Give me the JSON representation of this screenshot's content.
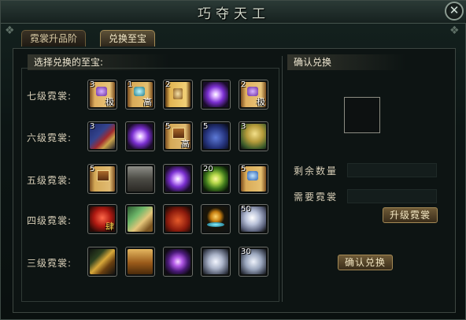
{
  "window": {
    "title": "巧夺天工"
  },
  "tabs": [
    {
      "label": "霓裳升品阶"
    },
    {
      "label": "兑换至宝"
    }
  ],
  "left": {
    "section_title": "选择兑换的至宝:",
    "rows": [
      {
        "label": "七级霓裳:",
        "items": [
          {
            "icon": "purple-seal-scroll-icon",
            "count": "3",
            "mark": "极"
          },
          {
            "icon": "teal-seal-scroll-icon",
            "count": "1",
            "mark": "高"
          },
          {
            "icon": "golden-scroll-icon",
            "count": "2",
            "mark": ""
          },
          {
            "icon": "purple-orb-icon",
            "count": "",
            "mark": ""
          },
          {
            "icon": "purple-seal-scroll-icon",
            "count": "2",
            "mark": "极"
          }
        ]
      },
      {
        "label": "六级霓裳:",
        "items": [
          {
            "icon": "book-box-icon",
            "count": "3",
            "mark": ""
          },
          {
            "icon": "purple-orb-icon",
            "count": "",
            "mark": ""
          },
          {
            "icon": "gold-chest-scroll-icon",
            "count": "5",
            "mark": "高"
          },
          {
            "icon": "blue-chest-icon",
            "count": "5",
            "mark": ""
          },
          {
            "icon": "jade-scroll-icon",
            "count": "3",
            "mark": ""
          }
        ]
      },
      {
        "label": "五级霓裳:",
        "items": [
          {
            "icon": "chest-scroll-icon",
            "count": "5",
            "mark": ""
          },
          {
            "icon": "metal-chest-icon",
            "count": "",
            "mark": ""
          },
          {
            "icon": "purple-orb-icon",
            "count": "",
            "mark": ""
          },
          {
            "icon": "green-orb-icon",
            "count": "20",
            "mark": ""
          },
          {
            "icon": "blue-seal-scroll-icon",
            "count": "5",
            "mark": ""
          }
        ]
      },
      {
        "label": "四级霓裳:",
        "items": [
          {
            "icon": "red-lantern-icon",
            "count": "",
            "mark": "肆"
          },
          {
            "icon": "jade-box-icon",
            "count": "",
            "mark": ""
          },
          {
            "icon": "red-bag-icon",
            "count": "",
            "mark": ""
          },
          {
            "icon": "gold-pearl-icon",
            "count": "",
            "mark": ""
          },
          {
            "icon": "silver-lump-icon",
            "count": "50",
            "mark": ""
          }
        ]
      },
      {
        "label": "三级霓裳:",
        "items": [
          {
            "icon": "gold-spear-icon",
            "count": "",
            "mark": ""
          },
          {
            "icon": "gold-chest-icon",
            "count": "",
            "mark": ""
          },
          {
            "icon": "purple-crystal-icon",
            "count": "",
            "mark": ""
          },
          {
            "icon": "silver-rock-icon",
            "count": "",
            "mark": ""
          },
          {
            "icon": "silver-orb-icon",
            "count": "30",
            "mark": ""
          }
        ]
      }
    ]
  },
  "right": {
    "section_title": "确认兑换",
    "remaining_label": "剩余数量",
    "remaining_value": "",
    "required_label": "需要霓裳",
    "required_value": "",
    "upgrade_button": "升级霓裳",
    "confirm_button": "确认兑换"
  }
}
